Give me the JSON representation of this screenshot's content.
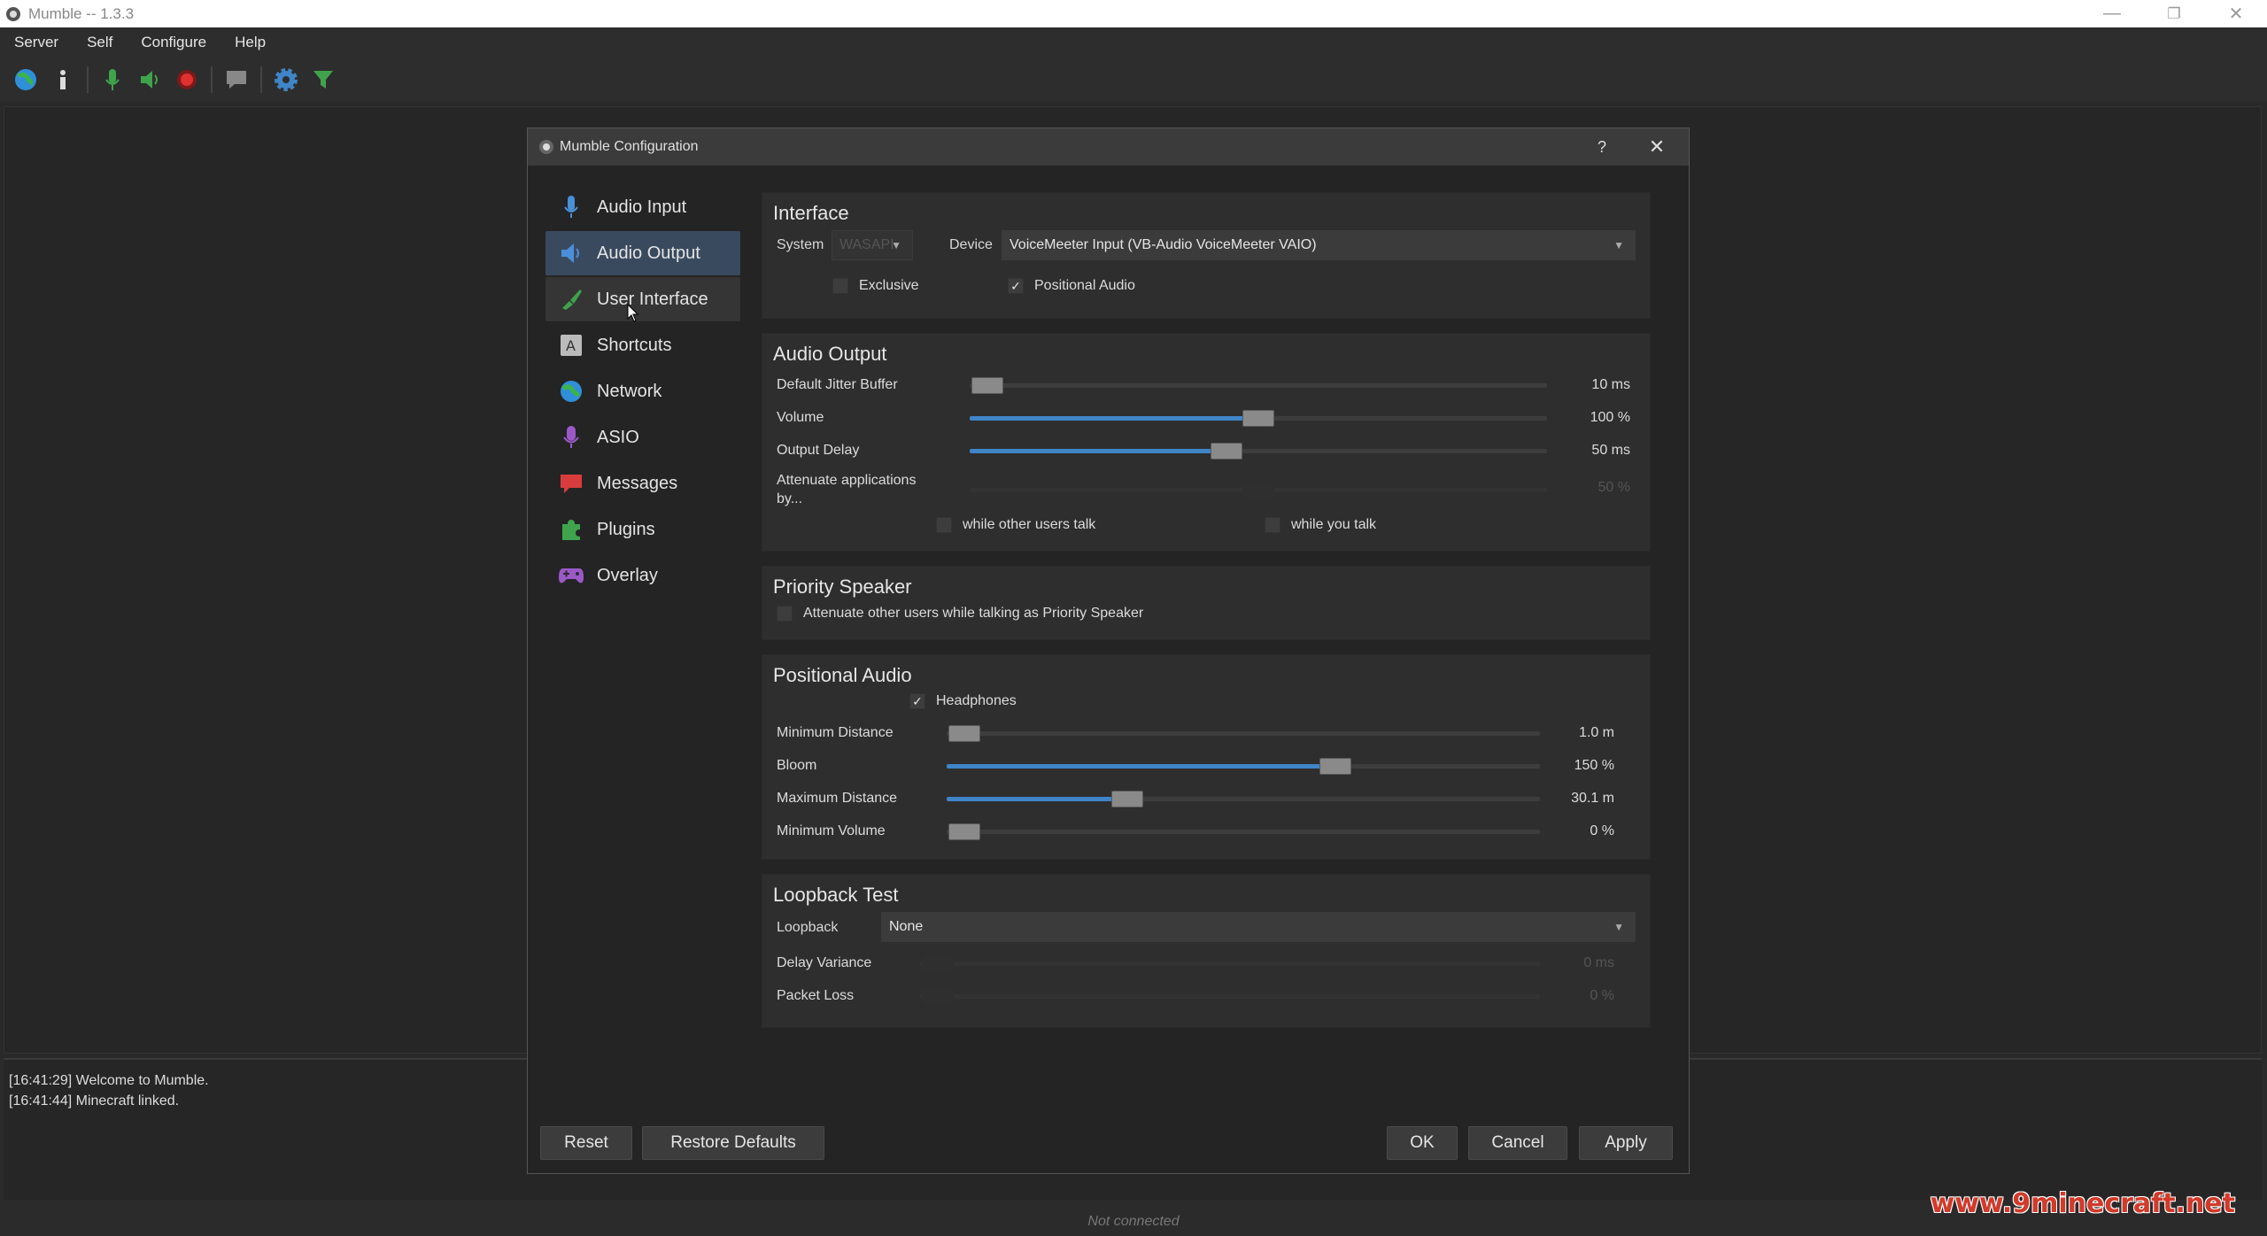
{
  "window": {
    "title": "Mumble -- 1.3.3",
    "minimize": "—",
    "maximize": "❐",
    "close": "✕"
  },
  "menu": [
    "Server",
    "Self",
    "Configure",
    "Help"
  ],
  "toolbar": {
    "icons": [
      "globe-icon",
      "info-icon",
      "microphone-icon",
      "speaker-icon",
      "record-icon",
      "chat-icon",
      "gear-icon",
      "filter-icon"
    ]
  },
  "log": [
    {
      "time": "[16:41:29]",
      "text": "Welcome to Mumble."
    },
    {
      "time": "[16:41:44]",
      "text": "Minecraft linked."
    }
  ],
  "status": "Not connected",
  "watermark": "www.9minecraft.net",
  "dialog": {
    "title": "Mumble Configuration",
    "help": "?",
    "close": "✕",
    "nav": [
      {
        "label": "Audio Input",
        "icon": "microphone-icon",
        "color": "#4a8fd8"
      },
      {
        "label": "Audio Output",
        "icon": "speaker-icon",
        "color": "#4a8fd8",
        "active": true
      },
      {
        "label": "User Interface",
        "icon": "brush-icon",
        "color": "#3fa34d"
      },
      {
        "label": "Shortcuts",
        "icon": "keyboard-key-icon",
        "color": "#aaaaaa"
      },
      {
        "label": "Network",
        "icon": "globe-icon",
        "color": "#3f9ad8"
      },
      {
        "label": "ASIO",
        "icon": "asio-microphone-icon",
        "color": "#9b59c7"
      },
      {
        "label": "Messages",
        "icon": "message-icon",
        "color": "#d83c3c"
      },
      {
        "label": "Plugins",
        "icon": "puzzle-icon",
        "color": "#3fa34d"
      },
      {
        "label": "Overlay",
        "icon": "gamepad-icon",
        "color": "#9b59c7"
      }
    ],
    "interface": {
      "title": "Interface",
      "system_label": "System",
      "system_value": "WASAPI",
      "device_label": "Device",
      "device_value": "VoiceMeeter Input (VB-Audio VoiceMeeter VAIO)",
      "exclusive_label": "Exclusive",
      "exclusive_checked": false,
      "positional_label": "Positional Audio",
      "positional_checked": true
    },
    "audio_output": {
      "title": "Audio Output",
      "jitter_label": "Default Jitter Buffer",
      "jitter_value": "10 ms",
      "jitter_fraction": 0.03,
      "volume_label": "Volume",
      "volume_value": "100 %",
      "volume_fraction": 0.5,
      "delay_label": "Output Delay",
      "delay_value": "50 ms",
      "delay_fraction": 0.445,
      "attenuate_label": "Attenuate applications by...",
      "attenuate_value": "50 %",
      "attenuate_fraction": 0.5,
      "while_others_label": "while other users talk",
      "while_you_label": "while you talk"
    },
    "priority": {
      "title": "Priority Speaker",
      "attenuate_label": "Attenuate other users while talking as Priority Speaker"
    },
    "positional": {
      "title": "Positional Audio",
      "headphones_label": "Headphones",
      "headphones_checked": true,
      "min_dist_label": "Minimum Distance",
      "min_dist_value": "1.0 m",
      "min_dist_fraction": 0.03,
      "bloom_label": "Bloom",
      "bloom_value": "150 %",
      "bloom_fraction": 0.655,
      "max_dist_label": "Maximum Distance",
      "max_dist_value": "30.1 m",
      "max_dist_fraction": 0.305,
      "min_vol_label": "Minimum Volume",
      "min_vol_value": "0 %",
      "min_vol_fraction": 0.03
    },
    "loopback": {
      "title": "Loopback Test",
      "loopback_label": "Loopback",
      "loopback_value": "None",
      "variance_label": "Delay Variance",
      "variance_value": "0 ms",
      "loss_label": "Packet Loss",
      "loss_value": "0 %"
    },
    "buttons": {
      "reset": "Reset",
      "restore": "Restore Defaults",
      "ok": "OK",
      "cancel": "Cancel",
      "apply": "Apply"
    }
  }
}
